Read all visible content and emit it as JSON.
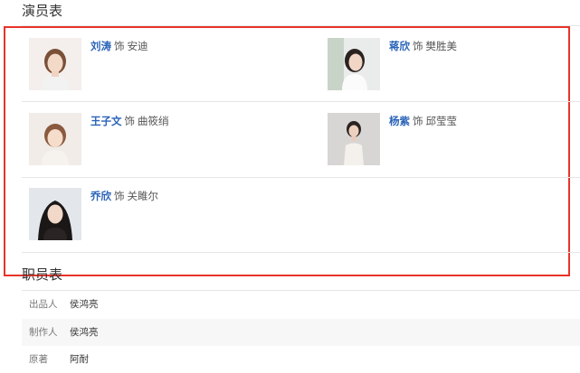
{
  "cast": {
    "title": "演员表",
    "as_word": "饰",
    "actors": [
      {
        "name": "刘涛",
        "role": "安迪"
      },
      {
        "name": "蒋欣",
        "role": "樊胜美"
      },
      {
        "name": "王子文",
        "role": "曲筱绡"
      },
      {
        "name": "杨紫",
        "role": "邱莹莹"
      },
      {
        "name": "乔欣",
        "role": "关雎尔"
      }
    ]
  },
  "crew": {
    "title": "职员表",
    "rows": [
      {
        "label": "出品人",
        "value": "侯鸿亮"
      },
      {
        "label": "制作人",
        "value": "侯鸿亮"
      },
      {
        "label": "原著",
        "value": "阿耐"
      }
    ]
  },
  "colors": {
    "link": "#2a63b8",
    "highlight_border": "#e8332a",
    "divider": "#e6e6e6",
    "row_alt": "#f7f7f7"
  }
}
